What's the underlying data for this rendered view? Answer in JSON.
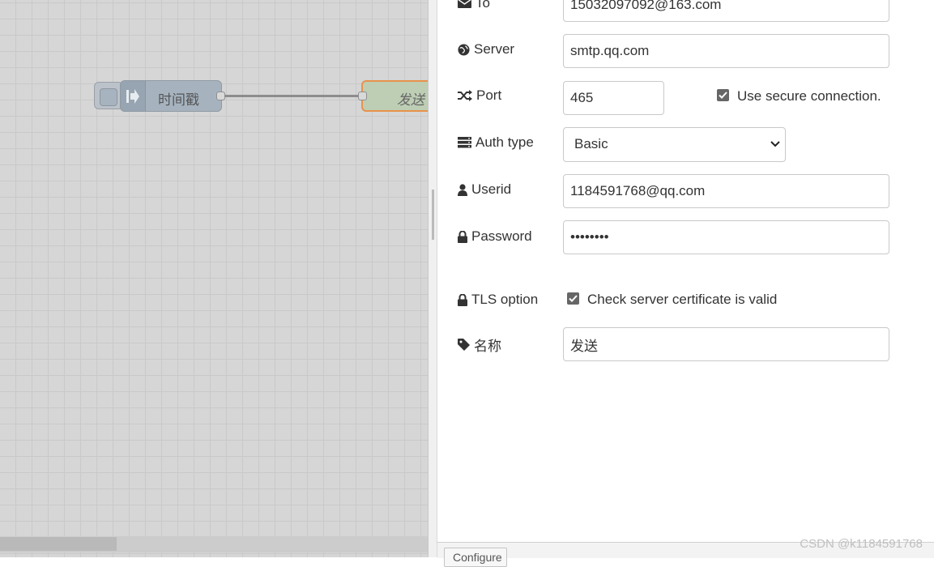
{
  "canvas": {
    "inject_node": {
      "label": "时间戳"
    },
    "email_node": {
      "label": "发送"
    }
  },
  "form": {
    "to": {
      "label": "To",
      "value": "15032097092@163.com"
    },
    "server": {
      "label": "Server",
      "value": "smtp.qq.com"
    },
    "port": {
      "label": "Port",
      "value": "465",
      "secure_label": "Use secure connection.",
      "secure_checked": true
    },
    "auth_type": {
      "label": "Auth type",
      "selected": "Basic"
    },
    "userid": {
      "label": "Userid",
      "value": "1184591768@qq.com"
    },
    "password": {
      "label": "Password",
      "value": "••••••••"
    },
    "tls": {
      "label": "TLS option",
      "check_label": "Check server certificate is valid",
      "checked": true
    },
    "name": {
      "label": "名称",
      "value": "发送"
    }
  },
  "footer": {
    "button_label": "Configure"
  },
  "watermark": "CSDN @k1184591768",
  "icons": {
    "to": "envelope-icon",
    "server": "globe-icon",
    "port": "random-icon",
    "auth": "server-icon",
    "userid": "user-icon",
    "password": "lock-icon",
    "tls": "lock-icon",
    "name": "tag-icon"
  }
}
